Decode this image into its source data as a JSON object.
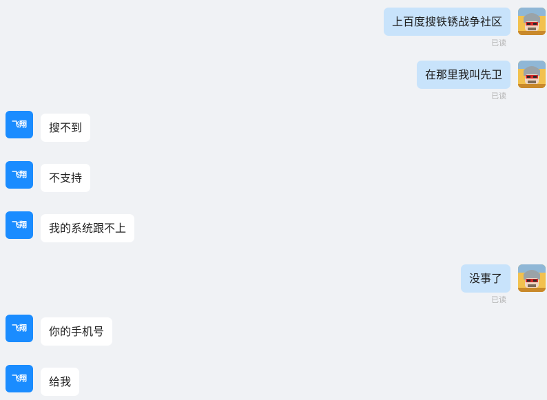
{
  "contact": {
    "avatar_text": "飞翔",
    "avatar_color": "#1a8cff"
  },
  "theme": {
    "outgoing_bubble": "#c8e3fb",
    "incoming_bubble": "#ffffff",
    "background": "#f0f2f5"
  },
  "messages": [
    {
      "direction": "out",
      "text": "上百度搜铁锈战争社区",
      "status": "已读"
    },
    {
      "direction": "out",
      "text": "在那里我叫先卫",
      "status": "已读"
    },
    {
      "direction": "in",
      "text": "搜不到"
    },
    {
      "direction": "in",
      "text": "不支持"
    },
    {
      "direction": "in",
      "text": "我的系统跟不上"
    },
    {
      "direction": "out",
      "text": "没事了",
      "status": "已读"
    },
    {
      "direction": "in",
      "text": "你的手机号"
    },
    {
      "direction": "in",
      "text": "给我"
    }
  ]
}
